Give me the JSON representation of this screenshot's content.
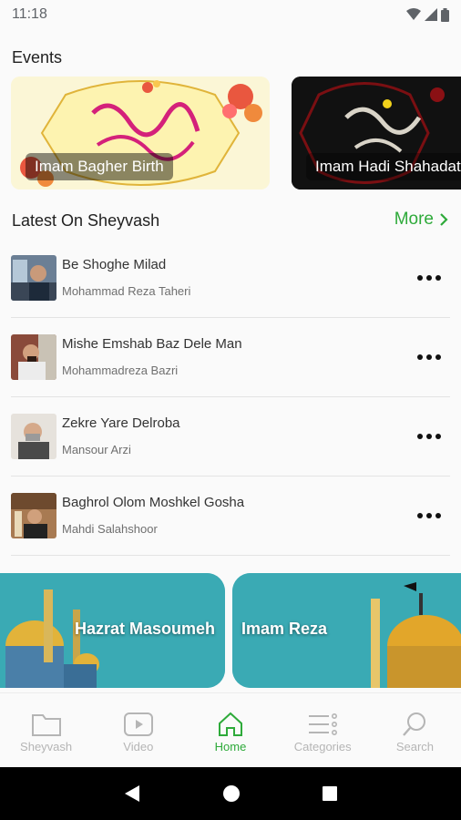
{
  "status_bar": {
    "time": "11:18",
    "icons": [
      "wifi-icon",
      "signal-icon",
      "battery-icon"
    ]
  },
  "events": {
    "title": "Events",
    "cards": [
      {
        "label": "Imam Bagher Birth"
      },
      {
        "label": "Imam Hadi Shahadat"
      }
    ]
  },
  "latest": {
    "title": "Latest On Sheyvash",
    "more_label": "More",
    "items": [
      {
        "title": "Be Shoghe Milad",
        "artist": "Mohammad Reza Taheri"
      },
      {
        "title": "Mishe Emshab Baz Dele Man",
        "artist": "Mohammadreza Bazri"
      },
      {
        "title": "Zekre Yare Delroba",
        "artist": "Mansour Arzi"
      },
      {
        "title": "Baghrol Olom Moshkel Gosha",
        "artist": "Mahdi Salahshoor"
      }
    ]
  },
  "shrines": [
    {
      "label": "Hazrat Masoumeh"
    },
    {
      "label": "Imam Reza"
    }
  ],
  "bottom_nav": {
    "items": [
      {
        "label": "Sheyvash",
        "icon": "folder-icon"
      },
      {
        "label": "Video",
        "icon": "play-icon"
      },
      {
        "label": "Home",
        "icon": "home-icon",
        "active": true
      },
      {
        "label": "Categories",
        "icon": "categories-icon"
      },
      {
        "label": "Search",
        "icon": "search-icon"
      }
    ]
  },
  "colors": {
    "accent": "#2eaa3a",
    "shrine_bg": "#3aaab4",
    "background": "#fafafa"
  }
}
